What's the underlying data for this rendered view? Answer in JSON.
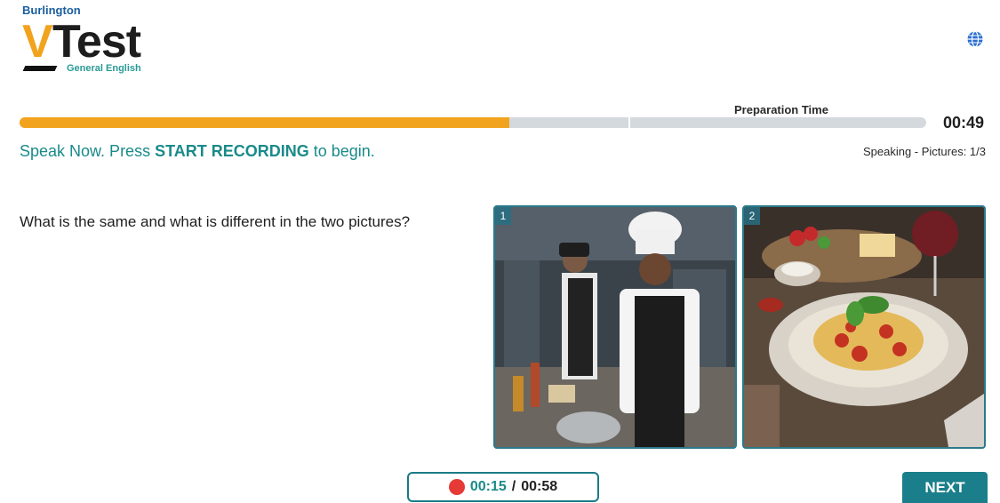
{
  "logo": {
    "brand": "Burlington",
    "v": "V",
    "test": "Test",
    "subtitle": "General English"
  },
  "header": {
    "language_icon": "globe-icon"
  },
  "timer": {
    "label": "Preparation Time",
    "remaining": "00:49",
    "progress_fraction": 0.54
  },
  "instruction": {
    "prefix": "Speak Now. Press ",
    "action": "START RECORDING",
    "suffix": " to begin."
  },
  "section": {
    "label": "Speaking - Pictures: 1/3"
  },
  "question": {
    "text": "What is the same and what is different in the two pictures?"
  },
  "pictures": [
    {
      "number": "1",
      "alt": "chefs cooking in kitchen"
    },
    {
      "number": "2",
      "alt": "plate of spaghetti"
    }
  ],
  "recording": {
    "elapsed": "00:15",
    "separator": "/",
    "total": "00:58"
  },
  "footer": {
    "next_label": "NEXT"
  },
  "colors": {
    "accent": "#1a7f8a",
    "progress": "#f2a31d",
    "record_dot": "#e53a35"
  }
}
